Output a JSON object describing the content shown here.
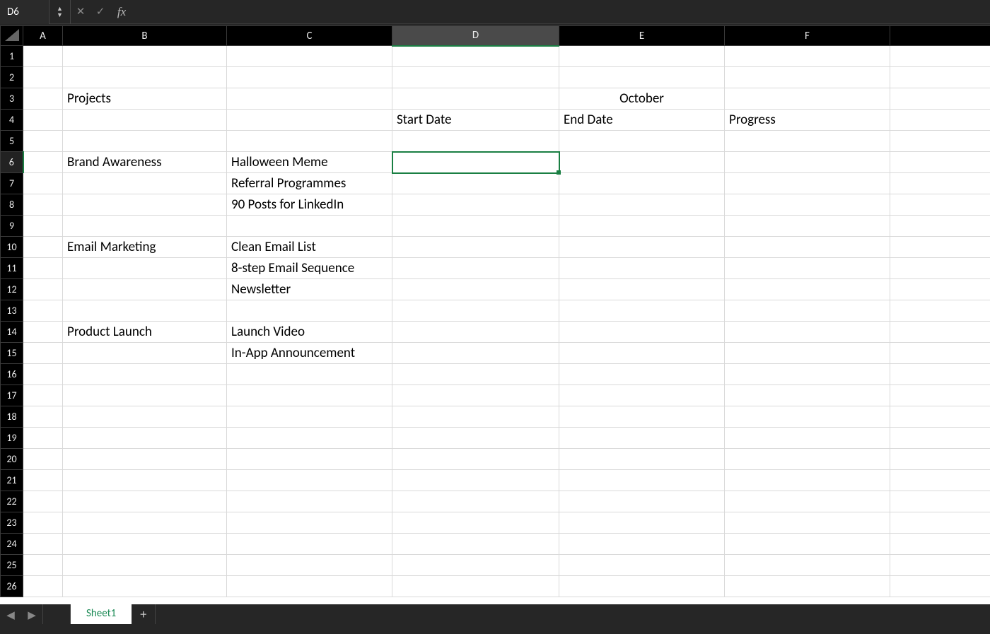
{
  "formula_bar": {
    "cell_ref": "D6",
    "value": "",
    "fx_label": "fx"
  },
  "sheet_tab": "Sheet1",
  "columns": [
    "A",
    "B",
    "C",
    "D",
    "E",
    "F"
  ],
  "row_count": 26,
  "active_cell": {
    "row": 6,
    "col": "D"
  },
  "cells": {
    "B3": "Projects",
    "E3": "October",
    "D4": "Start Date",
    "E4": "End Date",
    "F4": "Progress",
    "B6": "Brand Awareness",
    "C6": "Halloween Meme",
    "C7": "Referral Programmes",
    "C8": "90 Posts for LinkedIn",
    "B10": "Email Marketing",
    "C10": "Clean Email List",
    "C11": "8-step Email Sequence",
    "C12": "Newsletter",
    "B14": "Product Launch",
    "C14": "Launch Video",
    "C15": "In-App Announcement"
  }
}
